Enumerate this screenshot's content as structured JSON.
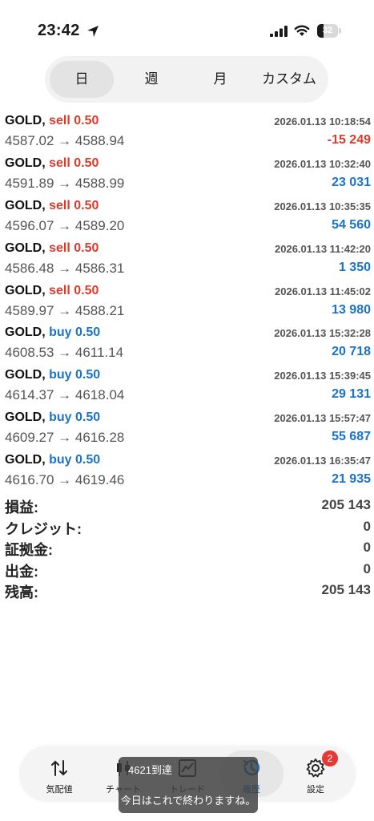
{
  "status_bar": {
    "time": "23:42",
    "battery": "32",
    "battery_level": 0.32
  },
  "period_tabs": [
    {
      "label": "日",
      "active": true
    },
    {
      "label": "週",
      "active": false
    },
    {
      "label": "月",
      "active": false
    },
    {
      "label": "カスタム",
      "active": false
    }
  ],
  "deals": [
    {
      "symbol": "GOLD,",
      "side": "sell 0.50",
      "type": "sell",
      "time": "2026.01.13 10:18:54",
      "prices": "4587.02 → 4588.94",
      "profit": "-15 249",
      "profit_sign": "neg"
    },
    {
      "symbol": "GOLD,",
      "side": "sell 0.50",
      "type": "sell",
      "time": "2026.01.13 10:32:40",
      "prices": "4591.89 → 4588.99",
      "profit": "23 031",
      "profit_sign": "pos"
    },
    {
      "symbol": "GOLD,",
      "side": "sell 0.50",
      "type": "sell",
      "time": "2026.01.13 10:35:35",
      "prices": "4596.07 → 4589.20",
      "profit": "54 560",
      "profit_sign": "pos"
    },
    {
      "symbol": "GOLD,",
      "side": "sell 0.50",
      "type": "sell",
      "time": "2026.01.13 11:42:20",
      "prices": "4586.48 → 4586.31",
      "profit": "1 350",
      "profit_sign": "pos"
    },
    {
      "symbol": "GOLD,",
      "side": "sell 0.50",
      "type": "sell",
      "time": "2026.01.13 11:45:02",
      "prices": "4589.97 → 4588.21",
      "profit": "13 980",
      "profit_sign": "pos"
    },
    {
      "symbol": "GOLD,",
      "side": "buy 0.50",
      "type": "buy",
      "time": "2026.01.13 15:32:28",
      "prices": "4608.53 → 4611.14",
      "profit": "20 718",
      "profit_sign": "pos"
    },
    {
      "symbol": "GOLD,",
      "side": "buy 0.50",
      "type": "buy",
      "time": "2026.01.13 15:39:45",
      "prices": "4614.37 → 4618.04",
      "profit": "29 131",
      "profit_sign": "pos"
    },
    {
      "symbol": "GOLD,",
      "side": "buy 0.50",
      "type": "buy",
      "time": "2026.01.13 15:57:47",
      "prices": "4609.27 → 4616.28",
      "profit": "55 687",
      "profit_sign": "pos"
    },
    {
      "symbol": "GOLD,",
      "side": "buy 0.50",
      "type": "buy",
      "time": "2026.01.13 16:35:47",
      "prices": "4616.70 → 4619.46",
      "profit": "21 935",
      "profit_sign": "pos"
    }
  ],
  "summary": [
    {
      "label": "損益:",
      "value": "205 143"
    },
    {
      "label": "クレジット:",
      "value": "0"
    },
    {
      "label": "証拠金:",
      "value": "0"
    },
    {
      "label": "出金:",
      "value": "0"
    },
    {
      "label": "残高:",
      "value": "205 143"
    }
  ],
  "bottom_nav": [
    {
      "label": "気配値",
      "icon": "quotes-arrows-icon",
      "active": false
    },
    {
      "label": "チャート",
      "icon": "candlestick-icon",
      "active": false
    },
    {
      "label": "トレード",
      "icon": "trade-chart-icon",
      "active": false
    },
    {
      "label": "履歴",
      "icon": "history-clock-icon",
      "active": true
    },
    {
      "label": "設定",
      "icon": "gear-icon",
      "active": false,
      "badge": "2"
    }
  ],
  "toast": {
    "line1": "4621到達",
    "line2": "今日はこれで終わりますね。"
  },
  "colors": {
    "sell": "#d93b2b",
    "buy": "#1a73c8",
    "profit_positive": "#1a73c8",
    "profit_negative": "#d93b2b",
    "badge": "#e53935"
  }
}
